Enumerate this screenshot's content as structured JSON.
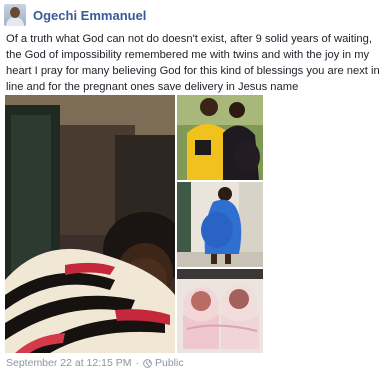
{
  "post": {
    "author": "Ogechi Emmanuel",
    "text": "Of a truth what God can not do doesn't exist, after 9 solid years of waiting, the God of impossibility remembered me with twins and with the joy in my heart I pray for many believing God for this kind of blessings you are next in line and for the pregnant ones save delivery in Jesus name",
    "timestamp": "September 22 at 12:15 PM",
    "separator": "·",
    "privacy": "Public",
    "privacy_icon": "globe-icon",
    "photos": [
      {
        "name": "selfie-photo"
      },
      {
        "name": "couple-photo"
      },
      {
        "name": "pregnant-woman-photo"
      },
      {
        "name": "newborn-twins-photo"
      }
    ]
  }
}
